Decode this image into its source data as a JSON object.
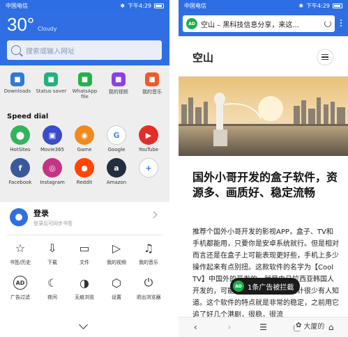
{
  "left": {
    "statusbar": {
      "carrier": "中国电信",
      "time": "下午4:29"
    },
    "weather": {
      "temp": "30°",
      "condition": "Cloudy"
    },
    "search": {
      "placeholder": "搜索或输入网址"
    },
    "quick": [
      {
        "label": "Downloads",
        "icon": "download-icon",
        "color": "#2f7ad8"
      },
      {
        "label": "Status saver",
        "icon": "status-saver-icon",
        "color": "#25b07f"
      },
      {
        "label": "WhatsApp file",
        "icon": "whatsapp-icon",
        "color": "#27b14a"
      },
      {
        "label": "我的视频",
        "icon": "video-icon",
        "color": "#8c3fe6"
      },
      {
        "label": "我的音乐",
        "icon": "music-icon",
        "color": "#f05a28"
      }
    ],
    "speed_dial_title": "Speed dial",
    "speed_dial": [
      {
        "label": "HotSites",
        "icon": "hotsites-icon",
        "color": "#33b35a",
        "glyph": "⬤"
      },
      {
        "label": "Movie365",
        "icon": "movie365-icon",
        "color": "#3a4cc9",
        "glyph": "▣"
      },
      {
        "label": "Game",
        "icon": "game-icon",
        "color": "#f08a1e",
        "glyph": "◉"
      },
      {
        "label": "Google",
        "icon": "google-icon",
        "color": "#ffffff",
        "glyph": "G"
      },
      {
        "label": "YouTube",
        "icon": "youtube-icon",
        "color": "#e52d27",
        "glyph": "▶"
      },
      {
        "label": "Facebook",
        "icon": "facebook-icon",
        "color": "#3b5998",
        "glyph": "f"
      },
      {
        "label": "Instagram",
        "icon": "instagram-icon",
        "color": "#c13584",
        "glyph": "◎"
      },
      {
        "label": "Reddit",
        "icon": "reddit-icon",
        "color": "#ff4500",
        "glyph": "●"
      },
      {
        "label": "Amazon",
        "icon": "amazon-icon",
        "color": "#232f3e",
        "glyph": "a"
      },
      {
        "label": "",
        "icon": "add-icon",
        "color": "#ffffff",
        "glyph": "+"
      }
    ],
    "login": {
      "title": "登录",
      "subtitle": "登录后可同步书签"
    },
    "menu": [
      {
        "label": "书签/历史",
        "icon": "star-icon",
        "glyph": "☆"
      },
      {
        "label": "下载",
        "icon": "download-arrow-icon",
        "glyph": "⇩"
      },
      {
        "label": "文件",
        "icon": "folder-icon",
        "glyph": "▭"
      },
      {
        "label": "我的视频",
        "icon": "video-play-icon",
        "glyph": "▷"
      },
      {
        "label": "我的音乐",
        "icon": "headphones-icon",
        "glyph": "♫"
      },
      {
        "label": "广告过滤",
        "icon": "ad-block-icon",
        "glyph": "AD"
      },
      {
        "label": "夜间",
        "icon": "night-mode-icon",
        "glyph": "☾"
      },
      {
        "label": "无痕浏览",
        "icon": "incognito-icon",
        "glyph": "◑"
      },
      {
        "label": "设置",
        "icon": "settings-icon",
        "glyph": "⬡"
      },
      {
        "label": "退出浏览器",
        "icon": "power-icon",
        "glyph": "⏻"
      }
    ]
  },
  "right": {
    "statusbar": {
      "carrier": "中国电信",
      "time": "下午4:29"
    },
    "url": {
      "badge": "AD",
      "text": "空山 – 黑科技信息分享，来这..."
    },
    "site": {
      "logo": "空山"
    },
    "article": {
      "title": "国外小哥开发的盒子软件，资源多、画质好、稳定流畅",
      "body": "推荐个国外小哥开发的影视APP，盒子、TV和手机都能用，只要你是安卓系统就行。但是相对而言还是在盒子上可能表现更好些，手机上多少操作起来有点别扭。这款软件的名字为【Cool TV】中国外的开发的，就是由马拉西亚韩国人开发的，可能是因为这个原因，估计很少有人知道。这个软件的特点就是非常的稳定，之前用它追了好几个港剧，很稳，很流"
    },
    "toast": {
      "badge": "AD",
      "text": "1条广告被拦截"
    },
    "watermark": "大厦的"
  }
}
